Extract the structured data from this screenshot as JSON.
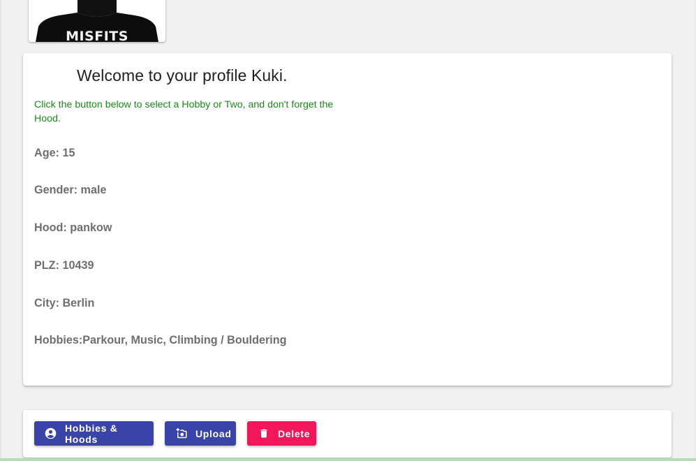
{
  "avatar": {
    "shirt_text": "MISFITS"
  },
  "profile": {
    "welcome": "Welcome to your profile Kuki.",
    "instruction": "Click the button below to select a Hobby or Two, and don't forget the Hood.",
    "fields": {
      "age": "Age: 15",
      "gender": "Gender: male",
      "hood": "Hood: pankow",
      "plz": "PLZ: 10439",
      "city": "City: Berlin",
      "hobbies": "Hobbies:Parkour, Music, Climbing / Bouldering"
    }
  },
  "actions": {
    "hobbies_hoods_label": "Hobbies & Hoods",
    "upload_label": "Upload",
    "delete_label": "Delete"
  },
  "icons": {
    "hobbies": "account-circle-icon",
    "upload": "add-photo-icon",
    "delete": "trash-icon"
  },
  "colors": {
    "primary": "#3a44a8",
    "danger": "#f2165a",
    "instruction_text": "#1b8a1b",
    "field_text": "#6f6f6f",
    "background": "#f1f1f1"
  }
}
